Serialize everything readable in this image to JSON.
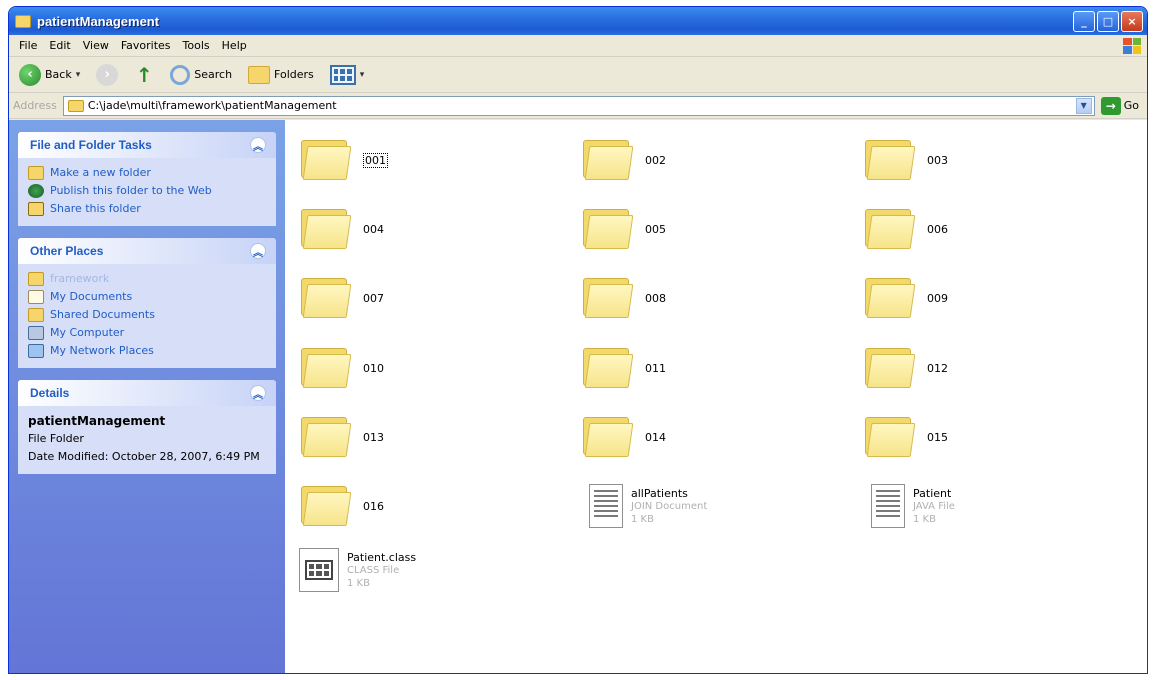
{
  "window": {
    "title": "patientManagement"
  },
  "menu": [
    "File",
    "Edit",
    "View",
    "Favorites",
    "Tools",
    "Help"
  ],
  "toolbar": {
    "back": "Back",
    "search": "Search",
    "folders": "Folders"
  },
  "address": {
    "label": "Address",
    "path": "C:\\jade\\multi\\framework\\patientManagement",
    "go": "Go"
  },
  "tasks": {
    "title": "File and Folder Tasks",
    "items": [
      "Make a new folder",
      "Publish this folder to the Web",
      "Share this folder"
    ]
  },
  "places": {
    "title": "Other Places",
    "items": [
      "framework",
      "My Documents",
      "Shared Documents",
      "My Computer",
      "My Network Places"
    ]
  },
  "details": {
    "title": "Details",
    "name": "patientManagement",
    "type": "File Folder",
    "modified": "Date Modified: October 28, 2007, 6:49 PM"
  },
  "folders": [
    "001",
    "002",
    "003",
    "004",
    "005",
    "006",
    "007",
    "008",
    "009",
    "010",
    "011",
    "012",
    "013",
    "014",
    "015",
    "016"
  ],
  "files": [
    {
      "name": "allPatients",
      "type": "JOIN Document",
      "size": "1 KB"
    },
    {
      "name": "Patient",
      "type": "JAVA File",
      "size": "1 KB"
    },
    {
      "name": "Patient.class",
      "type": "CLASS File",
      "size": "1 KB"
    }
  ]
}
